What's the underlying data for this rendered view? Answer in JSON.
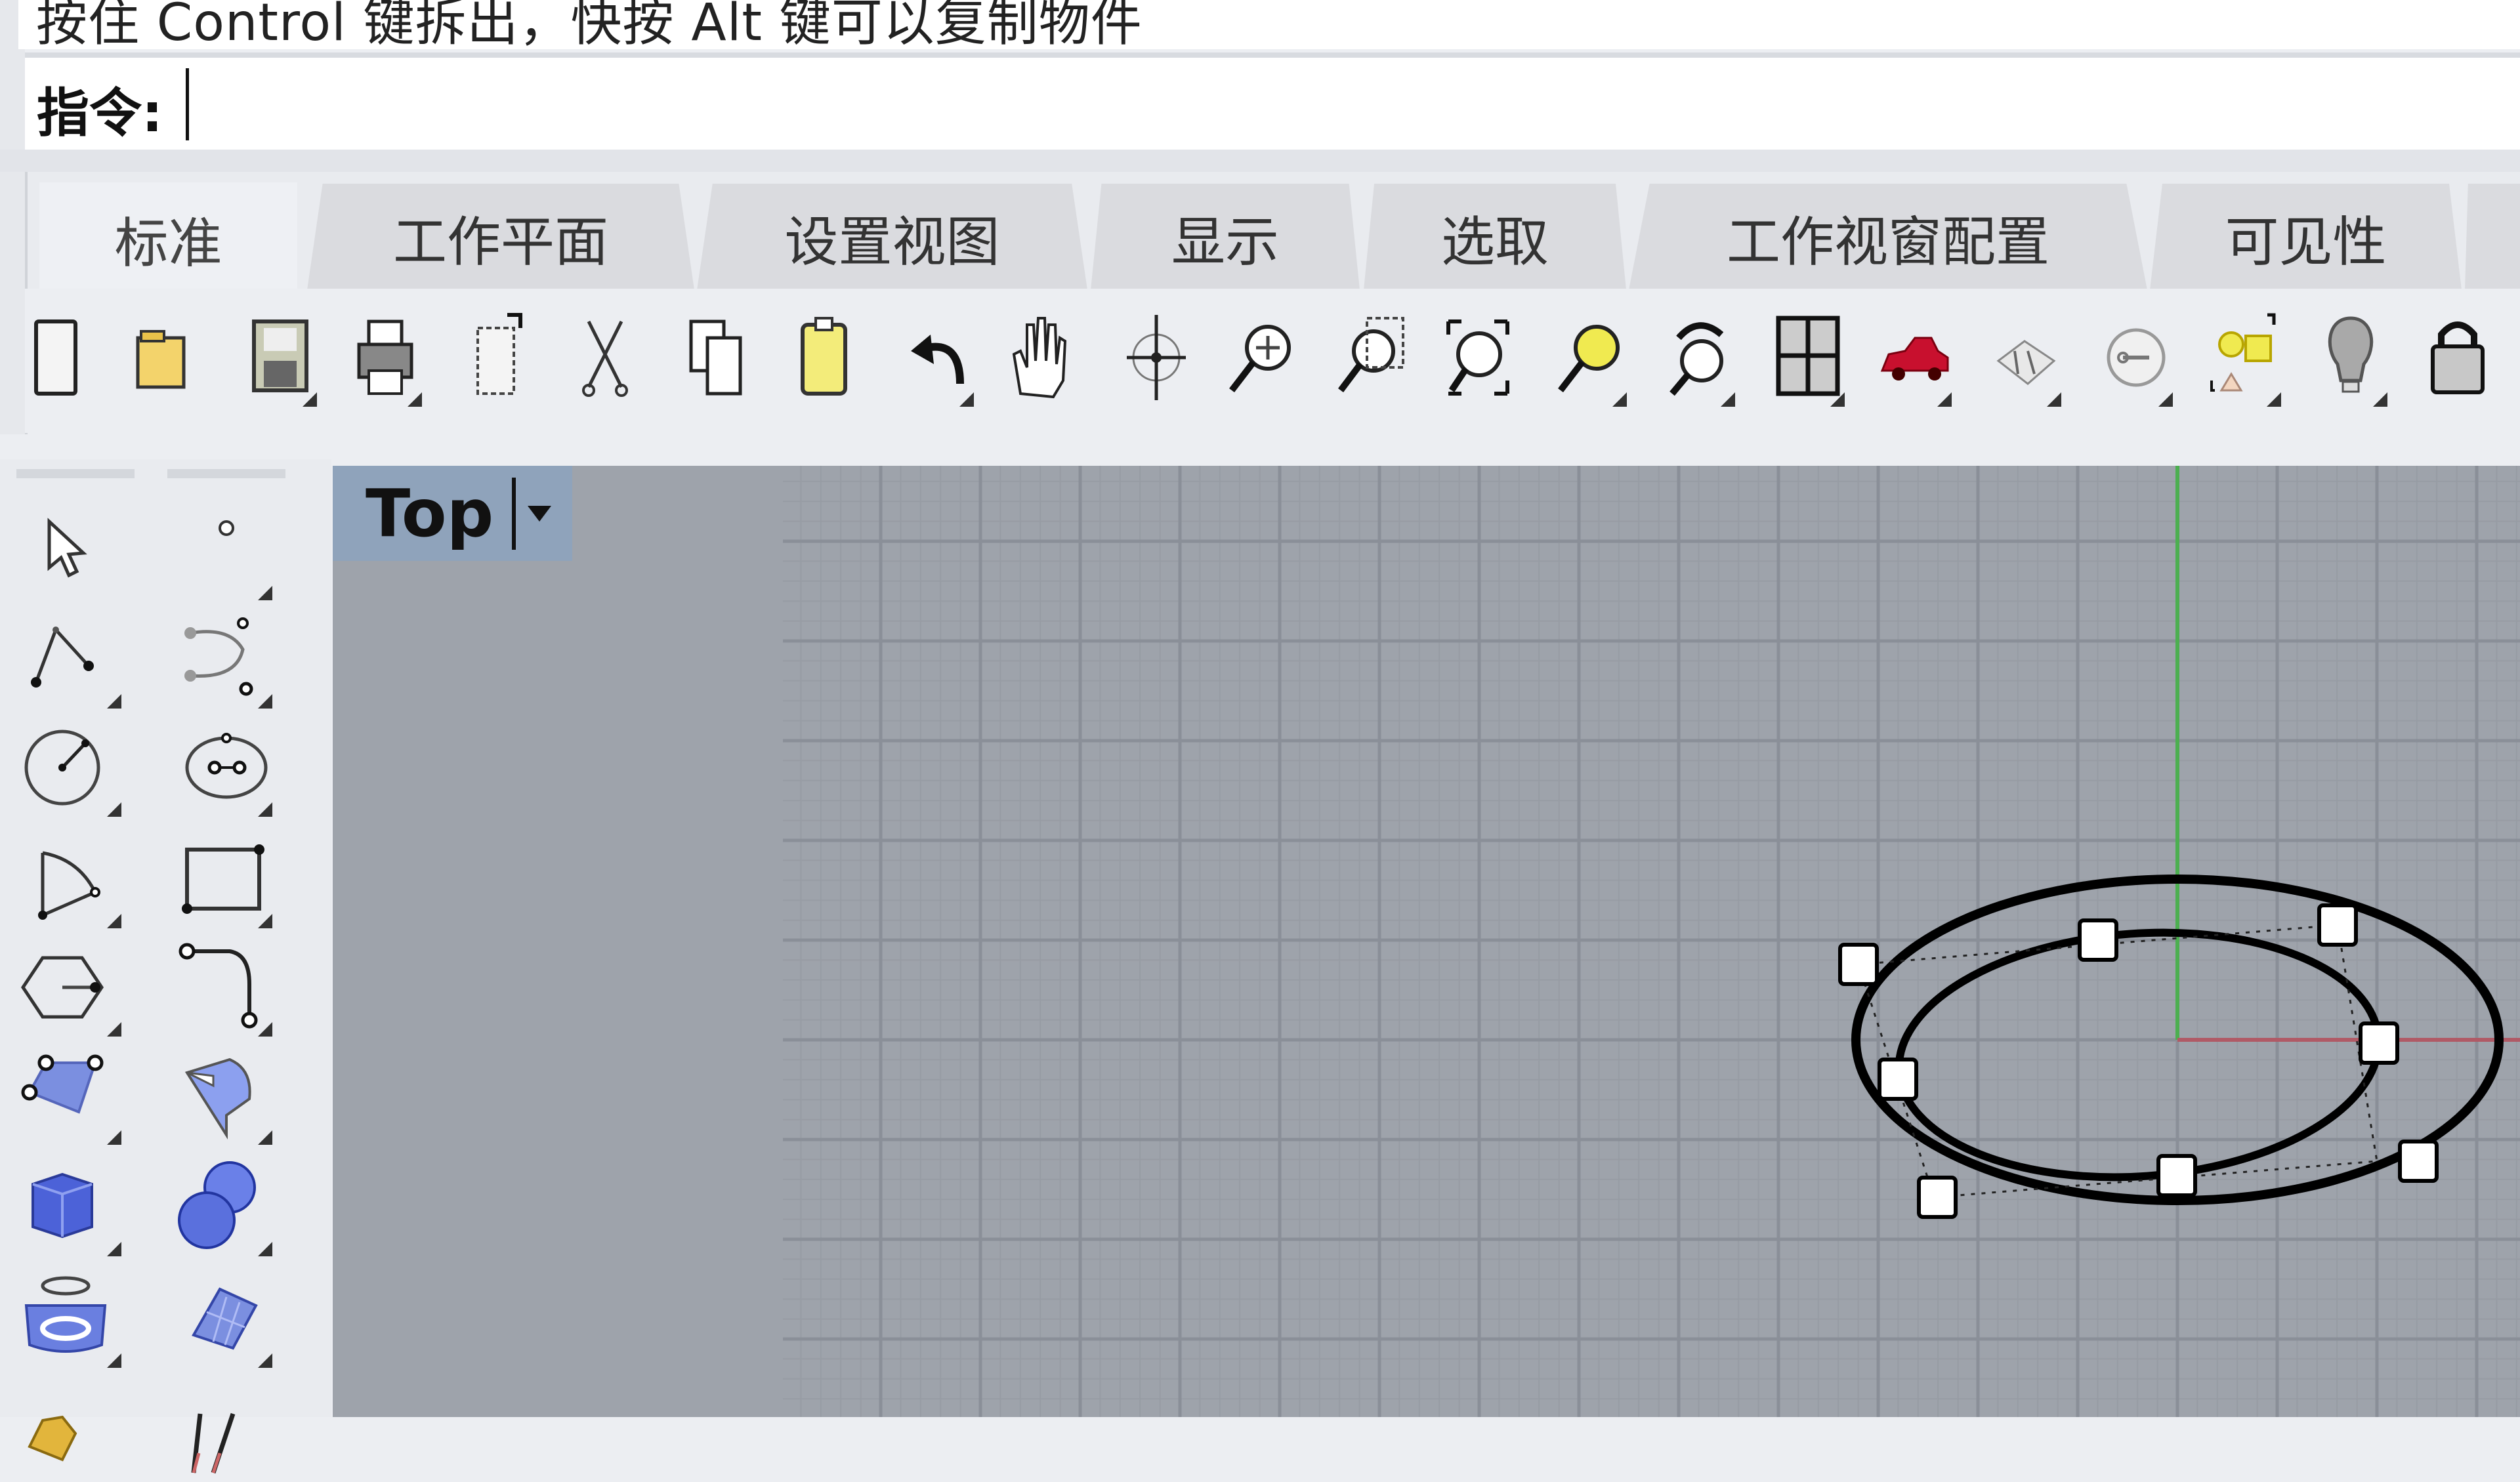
{
  "status_line": {
    "text": "按住 Control 键拆出，快按 Alt 键可以复制物件"
  },
  "command": {
    "label": "指令:",
    "value": "",
    "placeholder": ""
  },
  "tabs": [
    {
      "label": "标准",
      "active": true
    },
    {
      "label": "工作平面",
      "active": false
    },
    {
      "label": "设置视图",
      "active": false
    },
    {
      "label": "显示",
      "active": false
    },
    {
      "label": "选取",
      "active": false
    },
    {
      "label": "工作视窗配置",
      "active": false
    },
    {
      "label": "可见性",
      "active": false
    }
  ],
  "toolbar": {
    "icons": [
      {
        "name": "new-file-icon"
      },
      {
        "name": "open-folder-icon"
      },
      {
        "name": "save-icon"
      },
      {
        "name": "print-icon"
      },
      {
        "name": "import-icon"
      },
      {
        "name": "cut-icon"
      },
      {
        "name": "copy-icon"
      },
      {
        "name": "paste-icon"
      },
      {
        "name": "undo-icon"
      },
      {
        "name": "pan-hand-icon"
      },
      {
        "name": "rotate-view-icon"
      },
      {
        "name": "zoom-dynamic-icon"
      },
      {
        "name": "zoom-window-icon"
      },
      {
        "name": "zoom-extents-icon"
      },
      {
        "name": "zoom-selected-icon"
      },
      {
        "name": "undo-view-icon"
      },
      {
        "name": "four-viewports-icon"
      },
      {
        "name": "car-render-icon"
      },
      {
        "name": "materials-icon"
      },
      {
        "name": "cplane-icon"
      },
      {
        "name": "object-properties-icon"
      },
      {
        "name": "light-bulb-icon"
      },
      {
        "name": "lock-icon"
      }
    ]
  },
  "side_toolbar": {
    "col1": [
      {
        "name": "select-arrow-icon"
      },
      {
        "name": "polyline-icon"
      },
      {
        "name": "circle-icon"
      },
      {
        "name": "arc-icon"
      },
      {
        "name": "polygon-icon"
      },
      {
        "name": "surface-from-points-icon"
      },
      {
        "name": "solid-box-icon"
      },
      {
        "name": "extrude-icon"
      },
      {
        "name": "transform-icon"
      }
    ],
    "col2": [
      {
        "name": "point-icon"
      },
      {
        "name": "curve-icon"
      },
      {
        "name": "ellipse-icon"
      },
      {
        "name": "rectangle-icon"
      },
      {
        "name": "curve-fillet-icon"
      },
      {
        "name": "surface-edit-icon"
      },
      {
        "name": "boolean-union-icon"
      },
      {
        "name": "mesh-icon"
      },
      {
        "name": "dimension-icon"
      }
    ]
  },
  "viewport": {
    "title": "Top",
    "axis_colors": {
      "x": "#b05a66",
      "y": "#4caf50"
    },
    "background": "#9ea3ab",
    "selected_objects": [
      "outer-ellipse-curve",
      "inner-ellipse-curve"
    ]
  }
}
